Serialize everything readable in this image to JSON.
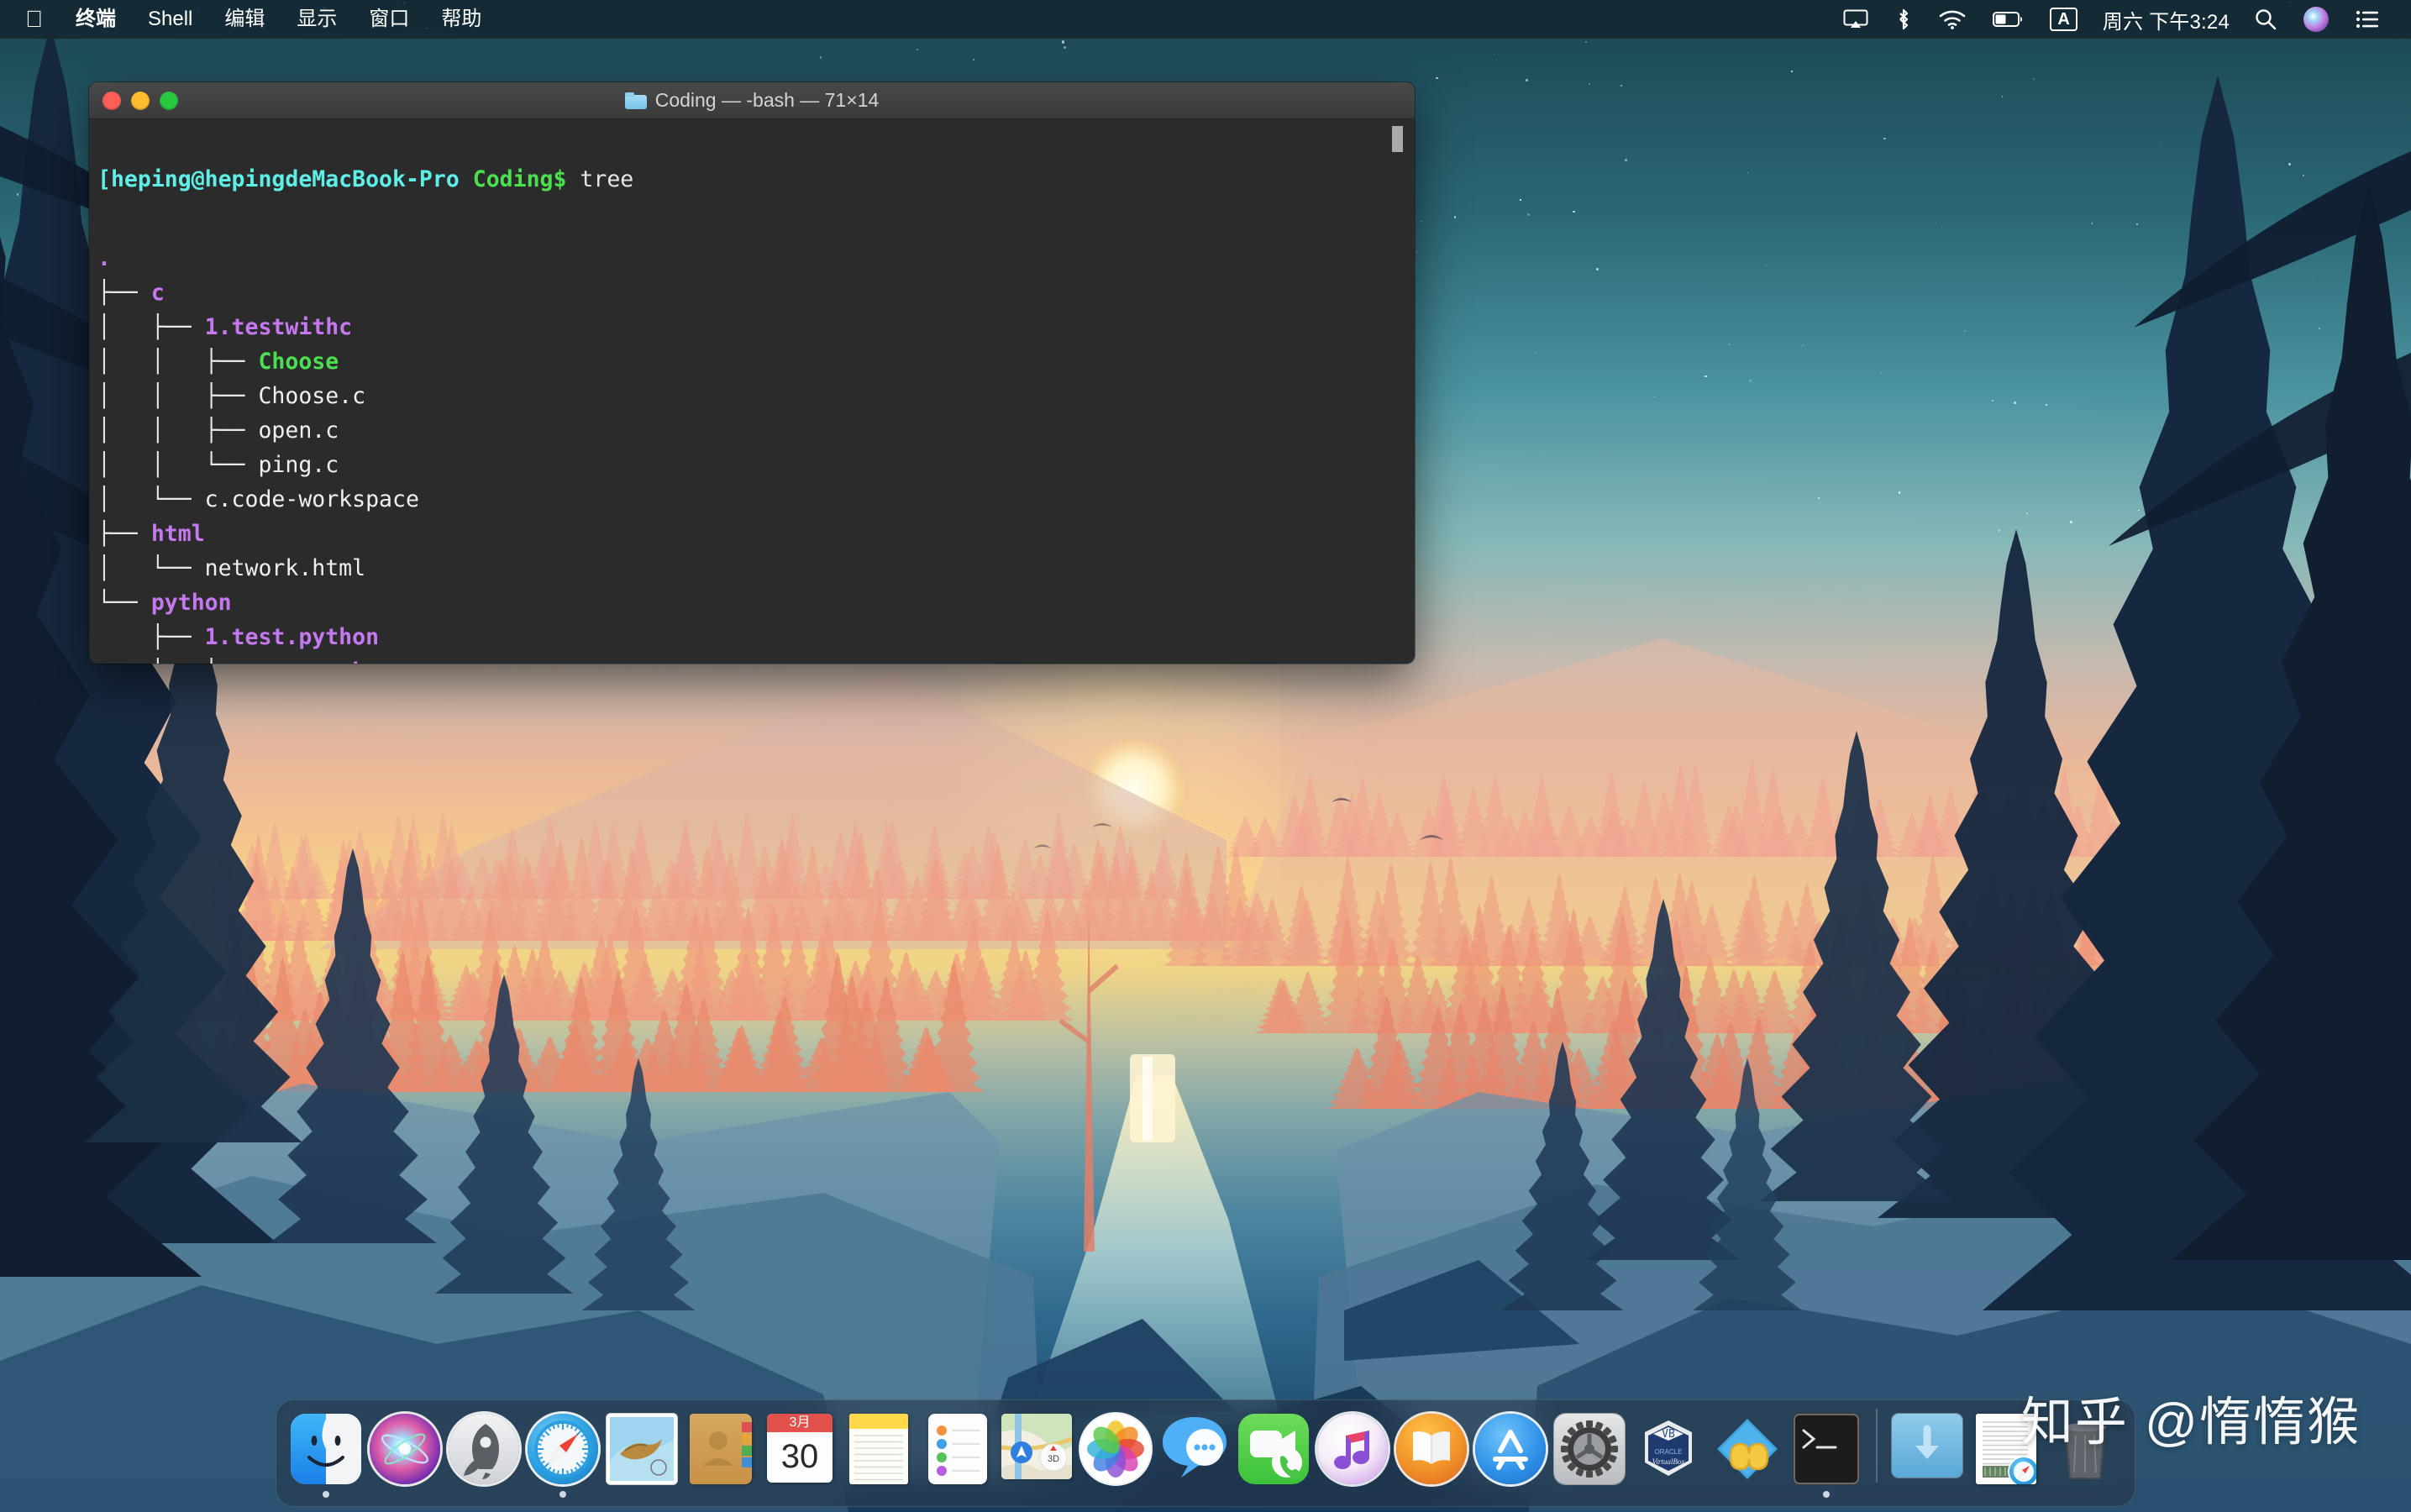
{
  "menubar": {
    "apple_icon": "apple-logo-icon",
    "items": [
      {
        "label": "终端",
        "name": "menu-terminal"
      },
      {
        "label": "Shell",
        "name": "menu-shell"
      },
      {
        "label": "编辑",
        "name": "menu-edit"
      },
      {
        "label": "显示",
        "name": "menu-view"
      },
      {
        "label": "窗口",
        "name": "menu-window"
      },
      {
        "label": "帮助",
        "name": "menu-help"
      }
    ],
    "status": {
      "airplay_icon": "airplay-icon",
      "bluetooth_icon": "bluetooth-icon",
      "wifi_icon": "wifi-icon",
      "battery_icon": "battery-icon",
      "input_source": "A",
      "clock": "周六 下午3:24",
      "search_icon": "search-icon",
      "siri_icon": "siri-icon",
      "control_center_icon": "control-center-icon"
    }
  },
  "terminal": {
    "title": "Coding — -bash — 71×14",
    "folder_icon": "folder-icon",
    "traffic_lights": {
      "close": "close-button",
      "minimize": "minimize-button",
      "zoom": "zoom-button"
    },
    "prompt": "[heping@hepingdeMacBook-Pro",
    "prompt_dir": "Coding$",
    "command": "tree",
    "lines": [
      {
        "tree": "",
        "name": ".",
        "kind": "dir_root"
      },
      {
        "tree": "├── ",
        "name": "c",
        "kind": "dir"
      },
      {
        "tree": "│   ├── ",
        "name": "1.testwithc",
        "kind": "dir"
      },
      {
        "tree": "│   │   ├── ",
        "name": "Choose",
        "kind": "exec"
      },
      {
        "tree": "│   │   ├── ",
        "name": "Choose.c",
        "kind": "file"
      },
      {
        "tree": "│   │   ├── ",
        "name": "open.c",
        "kind": "file"
      },
      {
        "tree": "│   │   └── ",
        "name": "ping.c",
        "kind": "file"
      },
      {
        "tree": "│   └── ",
        "name": "c.code-workspace",
        "kind": "file"
      },
      {
        "tree": "├── ",
        "name": "html",
        "kind": "dir"
      },
      {
        "tree": "│   └── ",
        "name": "network.html",
        "kind": "file"
      },
      {
        "tree": "└── ",
        "name": "python",
        "kind": "dir"
      },
      {
        "tree": "    ├── ",
        "name": "1.test.python",
        "kind": "dir"
      },
      {
        "tree": "    │   ├── ",
        "name": "__pycache__",
        "kind": "dir"
      }
    ],
    "colors": {
      "background": "#2b2b2b",
      "prompt": "#5ef0e8",
      "directory": "#c678f0",
      "executable": "#4ce051",
      "file": "#f0f0f0"
    }
  },
  "dock": {
    "items": [
      {
        "label": "Finder",
        "name": "dock-finder",
        "running": true
      },
      {
        "label": "Siri",
        "name": "dock-siri",
        "running": false
      },
      {
        "label": "启动台",
        "name": "dock-launchpad",
        "running": false
      },
      {
        "label": "Safari 浏览器",
        "name": "dock-safari",
        "running": true
      },
      {
        "label": "邮件",
        "name": "dock-mail",
        "running": false
      },
      {
        "label": "通讯录",
        "name": "dock-contacts",
        "running": false
      },
      {
        "label": "日历",
        "name": "dock-calendar",
        "running": false,
        "badge": "3月",
        "day": "30"
      },
      {
        "label": "备忘录",
        "name": "dock-notes",
        "running": false
      },
      {
        "label": "提醒事项",
        "name": "dock-reminders",
        "running": false
      },
      {
        "label": "地图",
        "name": "dock-maps",
        "running": false
      },
      {
        "label": "照片",
        "name": "dock-photos",
        "running": false
      },
      {
        "label": "信息",
        "name": "dock-messages",
        "running": false
      },
      {
        "label": "FaceTime 通话",
        "name": "dock-facetime",
        "running": false
      },
      {
        "label": "iTunes",
        "name": "dock-itunes",
        "running": false
      },
      {
        "label": "图书",
        "name": "dock-books",
        "running": false
      },
      {
        "label": "App Store",
        "name": "dock-appstore",
        "running": false
      },
      {
        "label": "系统偏好设置",
        "name": "dock-system-preferences",
        "running": false
      },
      {
        "label": "VirtualBox",
        "name": "dock-virtualbox",
        "running": false
      },
      {
        "label": "Anaconda-Navigator",
        "name": "dock-anaconda",
        "running": false
      },
      {
        "label": "终端",
        "name": "dock-terminal",
        "running": true
      }
    ],
    "right_items": [
      {
        "label": "下载",
        "name": "dock-downloads-stack"
      },
      {
        "label": "文稿",
        "name": "dock-document"
      },
      {
        "label": "废纸篓",
        "name": "dock-trash"
      }
    ]
  },
  "watermark": {
    "text": "知乎 @惰惰猴"
  }
}
